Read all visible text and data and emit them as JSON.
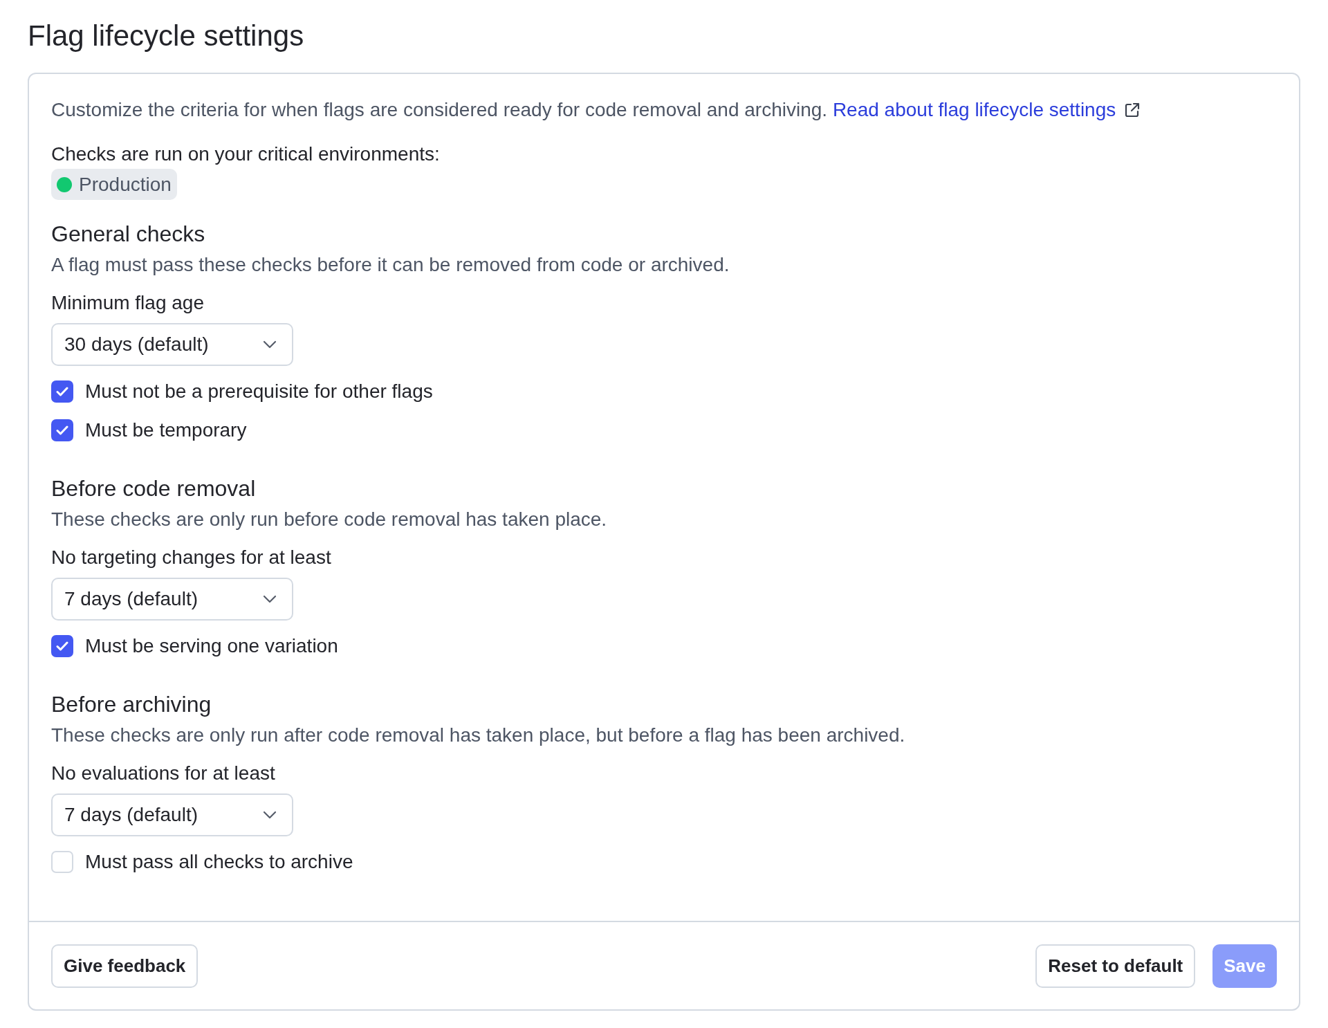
{
  "page": {
    "title": "Flag lifecycle settings"
  },
  "intro": {
    "text": "Customize the criteria for when flags are considered ready for code removal and archiving.",
    "link": "Read about flag lifecycle settings"
  },
  "environments": {
    "label": "Checks are run on your critical environments:",
    "items": [
      {
        "name": "Production",
        "color": "#12c870"
      }
    ]
  },
  "sections": [
    {
      "heading": "General checks",
      "description": "A flag must pass these checks before it can be removed from code or archived.",
      "field": {
        "label": "Minimum flag age",
        "value": "30 days (default)"
      },
      "checks": [
        {
          "label": "Must not be a prerequisite for other flags",
          "checked": true
        },
        {
          "label": "Must be temporary",
          "checked": true
        }
      ]
    },
    {
      "heading": "Before code removal",
      "description": "These checks are only run before code removal has taken place.",
      "field": {
        "label": "No targeting changes for at least",
        "value": "7 days (default)"
      },
      "checks": [
        {
          "label": "Must be serving one variation",
          "checked": true
        }
      ]
    },
    {
      "heading": "Before archiving",
      "description": "These checks are only run after code removal has taken place, but before a flag has been archived.",
      "field": {
        "label": "No evaluations for at least",
        "value": "7 days (default)"
      },
      "checks": [
        {
          "label": "Must pass all checks to archive",
          "checked": false
        }
      ]
    }
  ],
  "footer": {
    "left_buttons": [
      {
        "label": "Give feedback",
        "kind": "secondary",
        "disabled": false
      }
    ],
    "right_buttons": [
      {
        "label": "Reset to default",
        "kind": "secondary",
        "disabled": false
      },
      {
        "label": "Save",
        "kind": "primary",
        "disabled": true
      }
    ]
  }
}
